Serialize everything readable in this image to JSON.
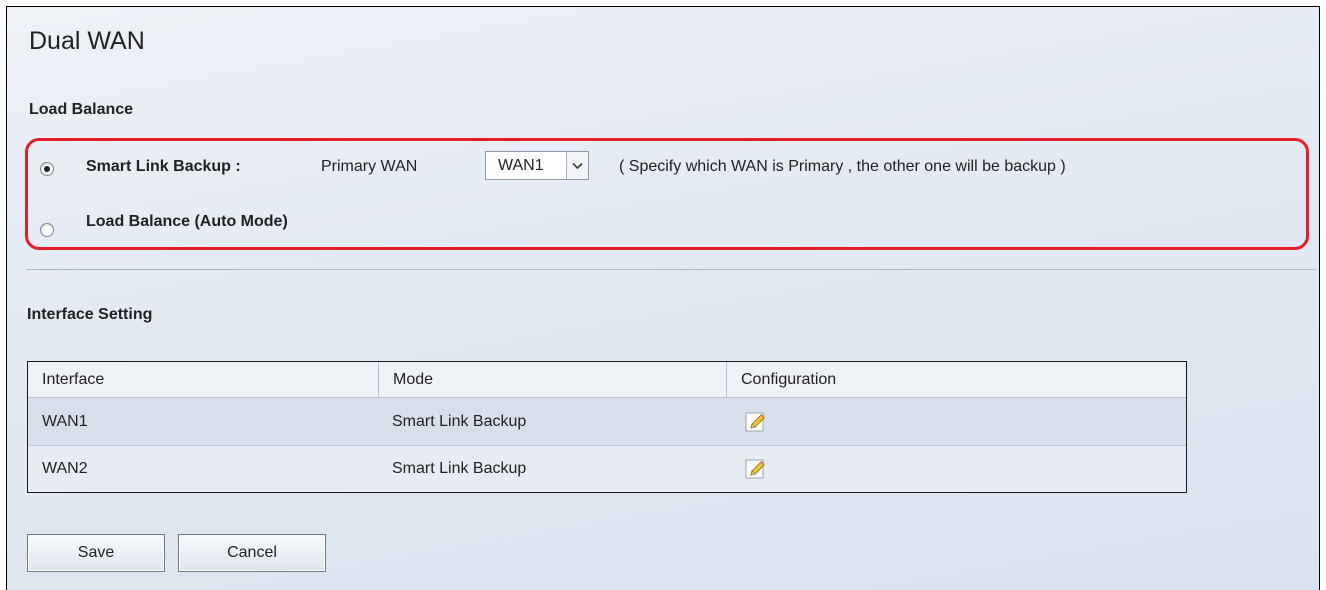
{
  "page": {
    "title": "Dual WAN"
  },
  "load_balance": {
    "heading": "Load Balance",
    "smart_link_backup": {
      "label": "Smart Link Backup :",
      "selected": true,
      "primary_wan_label": "Primary WAN",
      "primary_wan_value": "WAN1",
      "hint": "( Specify which WAN is Primary , the other one will be backup )"
    },
    "auto_mode": {
      "label": "Load Balance (Auto Mode)",
      "selected": false
    },
    "highlight_color": "#e2202c"
  },
  "interface_setting": {
    "heading": "Interface Setting",
    "columns": [
      "Interface",
      "Mode",
      "Configuration"
    ],
    "rows": [
      {
        "interface": "WAN1",
        "mode": "Smart Link Backup",
        "config_icon": "edit-pencil-icon"
      },
      {
        "interface": "WAN2",
        "mode": "Smart Link Backup",
        "config_icon": "edit-pencil-icon"
      }
    ]
  },
  "actions": {
    "save_label": "Save",
    "cancel_label": "Cancel"
  }
}
